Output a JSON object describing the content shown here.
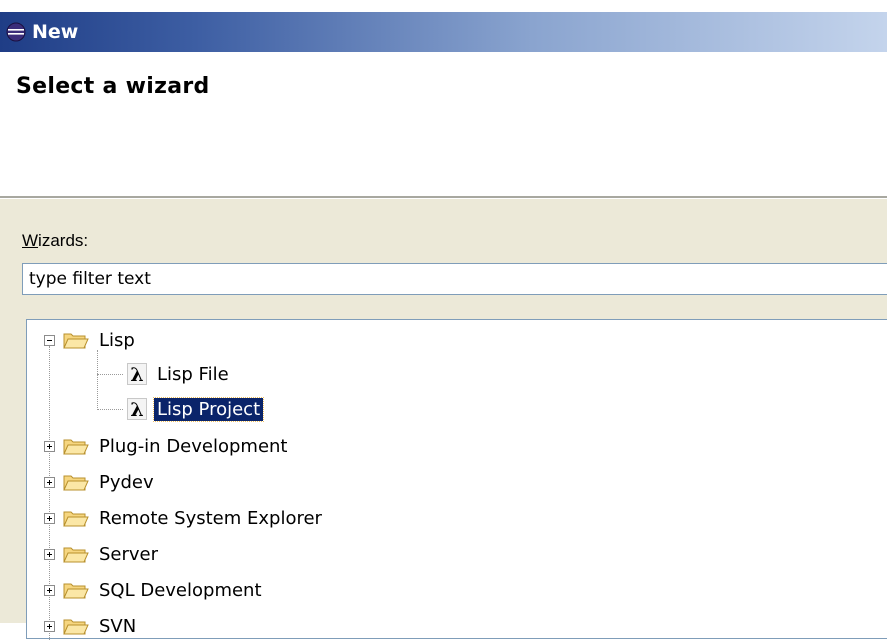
{
  "window": {
    "title": "New"
  },
  "header": {
    "page_title": "Select a wizard"
  },
  "wizards": {
    "label": "Wizards:",
    "filter_value": "type filter text"
  },
  "tree": {
    "lisp": {
      "label": "Lisp",
      "expanded": true
    },
    "lisp_file": {
      "label": "Lisp File",
      "icon": "lambda-icon",
      "icon_glyph": "λ"
    },
    "lisp_project": {
      "label": "Lisp Project",
      "icon": "lambda-icon",
      "icon_glyph": "λ",
      "selected": true
    },
    "plugin_dev": {
      "label": "Plug-in Development"
    },
    "pydev": {
      "label": "Pydev"
    },
    "rse": {
      "label": "Remote System Explorer"
    },
    "server": {
      "label": "Server"
    },
    "sql_dev": {
      "label": "SQL Development"
    },
    "svn": {
      "label": "SVN"
    }
  },
  "colors": {
    "title_bar_start": "#1f3d86",
    "selection_bg": "#0a246a",
    "folder_fill": "#f6d680",
    "dialog_bg": "#ece9d8"
  }
}
